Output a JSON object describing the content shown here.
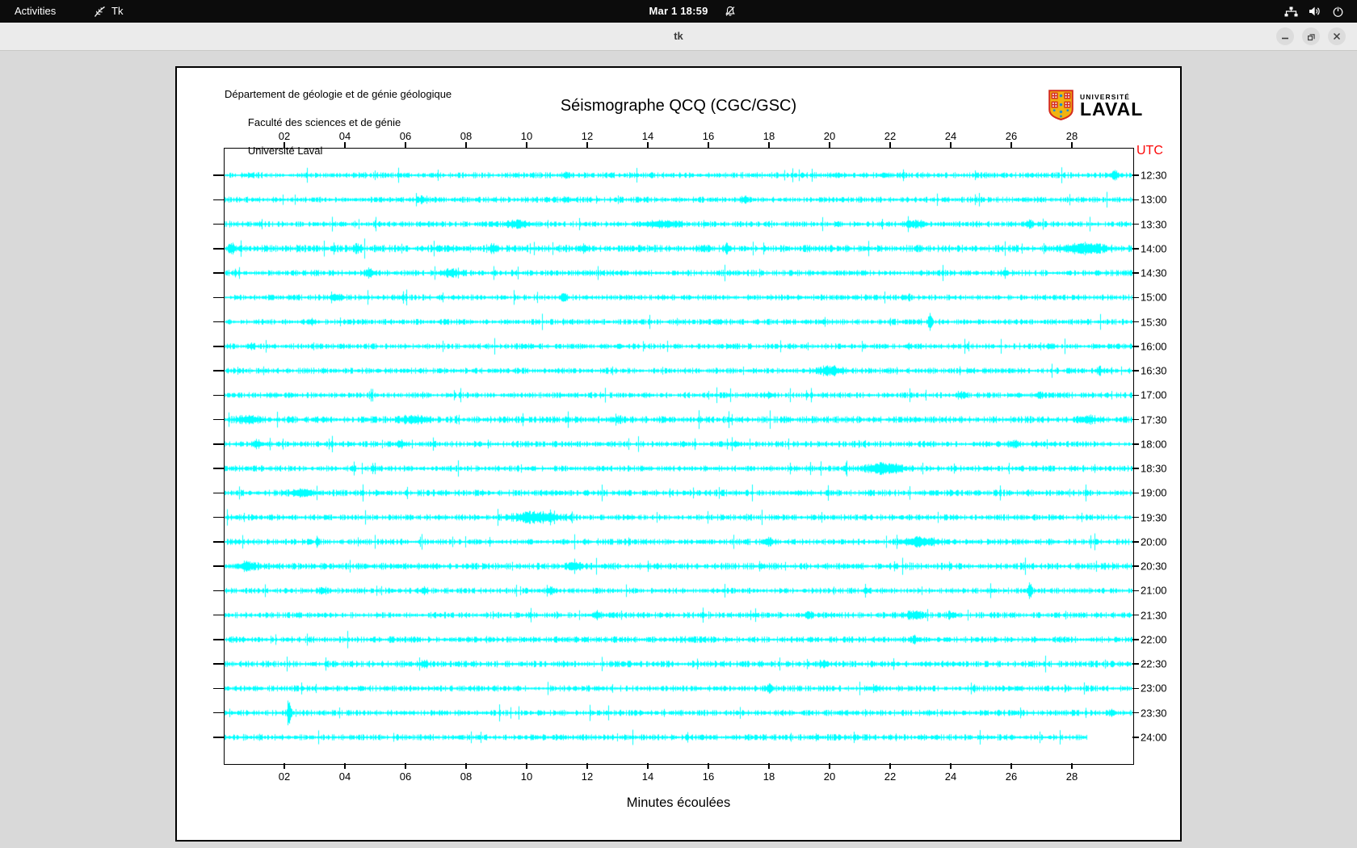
{
  "topbar": {
    "activities": "Activities",
    "app_name": "Tk",
    "clock": "Mar 1 18:59"
  },
  "titlebar": {
    "title": "tk"
  },
  "canvas_header": {
    "line1": "Département de géologie et de génie géologique",
    "line2": "Faculté des sciences et de génie",
    "line3": "Université Laval"
  },
  "logo": {
    "line1": "UNIVERSITÉ",
    "line2": "LAVAL"
  },
  "plot": {
    "title": "Séismographe QCQ (CGC/GSC)",
    "utc_label": "UTC",
    "x_label": "Minutes écoulées",
    "trace_color": "#00ffff",
    "utc_color": "#fb0707",
    "axis_color": "#000000"
  },
  "chart_data": {
    "type": "line",
    "title": "Séismographe QCQ (CGC/GSC)",
    "xlabel": "Minutes écoulées",
    "x_range": [
      0,
      30
    ],
    "x_ticks": [
      "02",
      "04",
      "06",
      "08",
      "10",
      "12",
      "14",
      "16",
      "18",
      "20",
      "22",
      "24",
      "26",
      "28"
    ],
    "y_axis_right_label": "UTC",
    "rows": [
      {
        "utc": "12:30",
        "base": 2.4,
        "end": 30,
        "events": [
          {
            "m": 11.3,
            "a": 2.5,
            "w": 0.08
          },
          {
            "m": 21.8,
            "a": 2.5,
            "w": 0.1
          },
          {
            "m": 29.4,
            "a": 5.5,
            "w": 0.07
          }
        ]
      },
      {
        "utc": "13:00",
        "base": 2.4,
        "end": 30,
        "events": [
          {
            "m": 6.5,
            "a": 2.5,
            "w": 0.1
          },
          {
            "m": 11.3,
            "a": 2,
            "w": 0.1
          },
          {
            "m": 17.2,
            "a": 3.5,
            "w": 0.07
          }
        ]
      },
      {
        "utc": "13:30",
        "base": 2.4,
        "end": 30,
        "events": [
          {
            "m": 9.7,
            "a": 3,
            "w": 0.3
          },
          {
            "m": 14.5,
            "a": 3,
            "w": 0.35
          },
          {
            "m": 22.8,
            "a": 3,
            "w": 0.25
          },
          {
            "m": 26.6,
            "a": 2.5,
            "w": 0.1
          }
        ]
      },
      {
        "utc": "14:00",
        "base": 3.0,
        "end": 30,
        "events": [
          {
            "m": 0.25,
            "a": 5,
            "w": 0.08
          },
          {
            "m": 4.4,
            "a": 3.5,
            "w": 0.08
          },
          {
            "m": 8.9,
            "a": 4,
            "w": 0.1
          },
          {
            "m": 11.9,
            "a": 3,
            "w": 0.08
          },
          {
            "m": 16.6,
            "a": 3.5,
            "w": 0.08
          },
          {
            "m": 28.4,
            "a": 5,
            "w": 0.45
          }
        ]
      },
      {
        "utc": "14:30",
        "base": 2.5,
        "end": 30,
        "events": [
          {
            "m": 4.8,
            "a": 3.5,
            "w": 0.08
          },
          {
            "m": 7.5,
            "a": 3,
            "w": 0.2
          },
          {
            "m": 25.8,
            "a": 2.5,
            "w": 0.08
          }
        ]
      },
      {
        "utc": "15:00",
        "base": 2.4,
        "end": 30,
        "events": [
          {
            "m": 3.7,
            "a": 3,
            "w": 0.15
          },
          {
            "m": 11.2,
            "a": 2.5,
            "w": 0.08
          }
        ]
      },
      {
        "utc": "15:30",
        "base": 2.4,
        "end": 30,
        "events": [
          {
            "m": 2.9,
            "a": 2.5,
            "w": 0.08
          },
          {
            "m": 23.3,
            "a": 11,
            "w": 0.04
          }
        ]
      },
      {
        "utc": "16:00",
        "base": 2.4,
        "end": 30,
        "events": [
          {
            "m": 0.9,
            "a": 2.5,
            "w": 0.08
          },
          {
            "m": 22.6,
            "a": 2.5,
            "w": 0.08
          },
          {
            "m": 27.3,
            "a": 2.5,
            "w": 0.08
          }
        ]
      },
      {
        "utc": "16:30",
        "base": 2.4,
        "end": 30,
        "events": [
          {
            "m": 20,
            "a": 4,
            "w": 0.3
          },
          {
            "m": 28.9,
            "a": 3.5,
            "w": 0.07
          }
        ]
      },
      {
        "utc": "17:00",
        "base": 2.4,
        "end": 30,
        "events": [
          {
            "m": 18,
            "a": 2.5,
            "w": 0.08
          },
          {
            "m": 24.3,
            "a": 2.5,
            "w": 0.1
          },
          {
            "m": 26.9,
            "a": 2.5,
            "w": 0.1
          }
        ]
      },
      {
        "utc": "17:30",
        "base": 2.8,
        "end": 30,
        "events": [
          {
            "m": 0.8,
            "a": 3,
            "w": 0.25
          },
          {
            "m": 6.3,
            "a": 3,
            "w": 0.3
          },
          {
            "m": 13,
            "a": 2.5,
            "w": 0.1
          },
          {
            "m": 28.5,
            "a": 3.5,
            "w": 0.2
          }
        ]
      },
      {
        "utc": "18:00",
        "base": 2.5,
        "end": 30,
        "events": [
          {
            "m": 1.1,
            "a": 3.5,
            "w": 0.12
          },
          {
            "m": 5.8,
            "a": 4,
            "w": 0.08
          },
          {
            "m": 16.9,
            "a": 2.5,
            "w": 0.08
          },
          {
            "m": 26.1,
            "a": 3.5,
            "w": 0.1
          }
        ]
      },
      {
        "utc": "18:30",
        "base": 2.5,
        "end": 30,
        "events": [
          {
            "m": 21.8,
            "a": 5.5,
            "w": 0.4
          }
        ]
      },
      {
        "utc": "19:00",
        "base": 2.6,
        "end": 30,
        "events": [
          {
            "m": 2.6,
            "a": 4,
            "w": 0.25
          }
        ]
      },
      {
        "utc": "19:30",
        "base": 2.5,
        "end": 30,
        "events": [
          {
            "m": 10.3,
            "a": 5,
            "w": 0.55
          }
        ]
      },
      {
        "utc": "20:00",
        "base": 2.5,
        "end": 30,
        "events": [
          {
            "m": 18,
            "a": 3.5,
            "w": 0.1
          },
          {
            "m": 23,
            "a": 4.5,
            "w": 0.35
          }
        ]
      },
      {
        "utc": "20:30",
        "base": 2.8,
        "end": 30,
        "events": [
          {
            "m": 0.8,
            "a": 4,
            "w": 0.2
          },
          {
            "m": 11.6,
            "a": 3.5,
            "w": 0.15
          }
        ]
      },
      {
        "utc": "21:00",
        "base": 2.4,
        "end": 30,
        "events": [
          {
            "m": 3.3,
            "a": 2.5,
            "w": 0.08
          },
          {
            "m": 6.6,
            "a": 2.5,
            "w": 0.08
          },
          {
            "m": 10.8,
            "a": 2.5,
            "w": 0.08
          },
          {
            "m": 26.6,
            "a": 9,
            "w": 0.05
          }
        ]
      },
      {
        "utc": "21:30",
        "base": 2.5,
        "end": 30,
        "events": [
          {
            "m": 12.3,
            "a": 3.5,
            "w": 0.1
          },
          {
            "m": 19.3,
            "a": 4.5,
            "w": 0.07
          },
          {
            "m": 22.8,
            "a": 3.5,
            "w": 0.18
          },
          {
            "m": 24,
            "a": 2.5,
            "w": 0.1
          }
        ]
      },
      {
        "utc": "22:00",
        "base": 2.6,
        "end": 30,
        "events": [
          {
            "m": 22.8,
            "a": 2.5,
            "w": 0.1
          }
        ]
      },
      {
        "utc": "22:30",
        "base": 2.7,
        "end": 30,
        "events": [
          {
            "m": 6.6,
            "a": 4.5,
            "w": 0.08
          },
          {
            "m": 19.8,
            "a": 2.5,
            "w": 0.1
          }
        ]
      },
      {
        "utc": "23:00",
        "base": 2.5,
        "end": 30,
        "events": [
          {
            "m": 18,
            "a": 3.5,
            "w": 0.07
          },
          {
            "m": 21.5,
            "a": 2.5,
            "w": 0.1
          }
        ]
      },
      {
        "utc": "23:30",
        "base": 2.5,
        "end": 30,
        "events": [
          {
            "m": 2.15,
            "a": 14.5,
            "w": 0.045
          },
          {
            "m": 29.3,
            "a": 2.5,
            "w": 0.08
          }
        ]
      },
      {
        "utc": "24:00",
        "base": 2.5,
        "end": 28.5,
        "events": []
      }
    ]
  }
}
